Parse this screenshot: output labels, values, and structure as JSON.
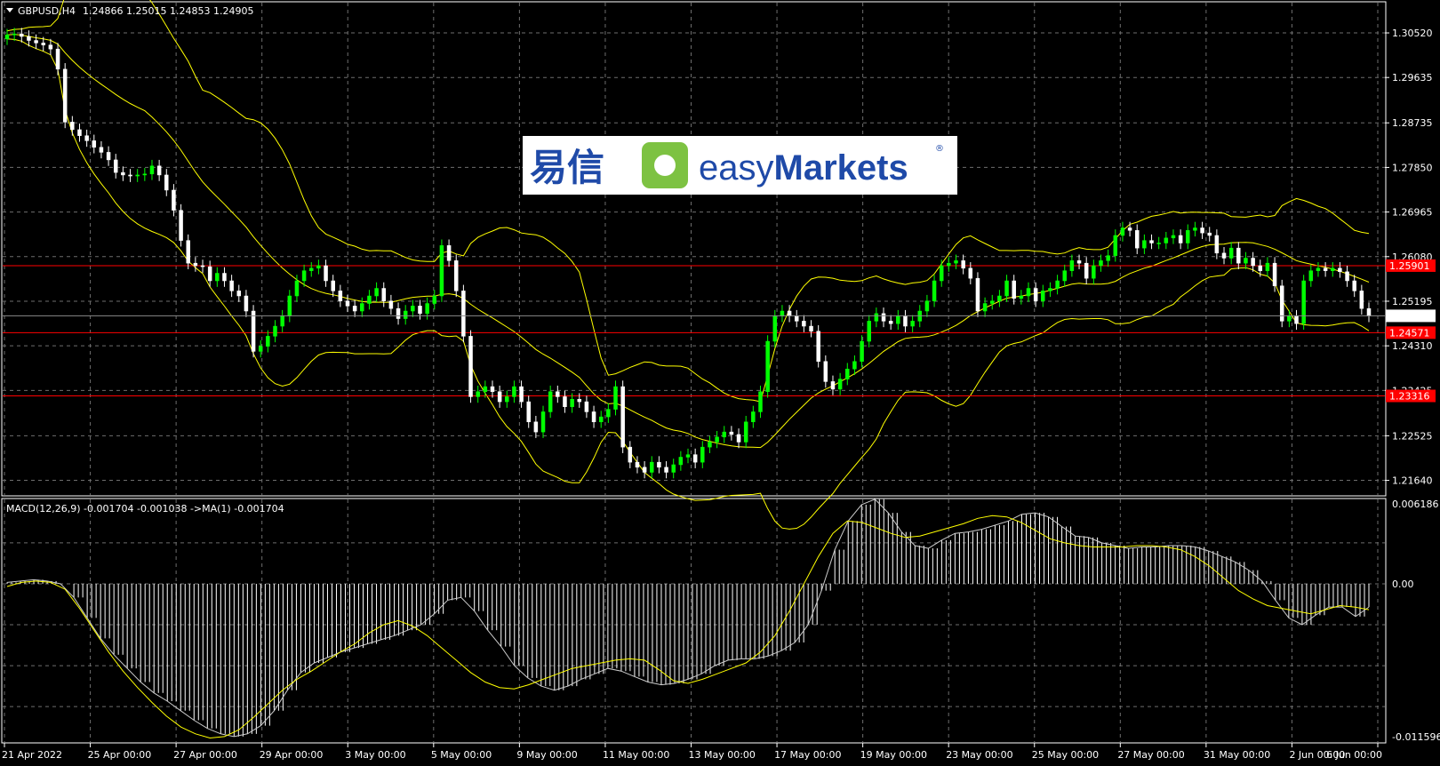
{
  "header": {
    "symbol": "GBPUSD,H4",
    "ohlc": "1.24866 1.25015 1.24853 1.24905"
  },
  "logo": {
    "cn_text": "易信",
    "brand_easy": "easy",
    "brand_markets": "Markets",
    "registered": "®"
  },
  "colors": {
    "background": "#000000",
    "bull_body": "#00ff00",
    "bear_body": "#ffffff",
    "bollinger": "#ffff00",
    "level_lines": "#ff0000",
    "macd_hist": "#ffffff",
    "macd_signal": "#ffff00",
    "grid": "#6e6e6e"
  },
  "price_axis": {
    "ticks": [
      "1.30520",
      "1.29635",
      "1.28735",
      "1.27850",
      "1.26965",
      "1.26080",
      "1.25195",
      "1.24310",
      "1.23425",
      "1.22525",
      "1.21640"
    ],
    "current_price": "1.24905"
  },
  "levels": [
    {
      "label": "1.25901",
      "value": 1.25901
    },
    {
      "label": "1.24571",
      "value": 1.24571
    },
    {
      "label": "1.23316",
      "value": 1.23316
    }
  ],
  "macd_panel": {
    "label": "MACD(12,26,9) -0.001704 -0.001038  ->MA(1) -0.001704",
    "ticks": [
      "0.006186",
      "0.00",
      "-0.011596"
    ]
  },
  "time_axis": {
    "labels": [
      "21 Apr 2022",
      "25 Apr 00:00",
      "27 Apr 00:00",
      "29 Apr 00:00",
      "3 May 00:00",
      "5 May 00:00",
      "9 May 00:00",
      "11 May 00:00",
      "13 May 00:00",
      "17 May 00:00",
      "19 May 00:00",
      "23 May 00:00",
      "25 May 00:00",
      "27 May 00:00",
      "31 May 00:00",
      "2 Jun 00:00",
      "6 Jun 00:00"
    ]
  },
  "chart_data": [
    {
      "type": "candlestick",
      "title": "GBPUSD,H4",
      "ylim": [
        1.2135,
        1.3112
      ],
      "series": [
        {
          "name": "close",
          "values": [
            1.3048,
            1.305,
            1.3045,
            1.3037,
            1.3032,
            1.3028,
            1.302,
            1.298,
            1.2875,
            1.286,
            1.2848,
            1.2838,
            1.2825,
            1.2815,
            1.28,
            1.2775,
            1.277,
            1.2768,
            1.277,
            1.2772,
            1.2788,
            1.277,
            1.274,
            1.27,
            1.264,
            1.2595,
            1.259,
            1.2588,
            1.256,
            1.2575,
            1.256,
            1.254,
            1.253,
            1.25,
            1.242,
            1.243,
            1.245,
            1.247,
            1.249,
            1.253,
            1.256,
            1.258,
            1.2585,
            1.259,
            1.256,
            1.254,
            1.252,
            1.251,
            1.25,
            1.2515,
            1.253,
            1.2545,
            1.252,
            1.2505,
            1.2485,
            1.25,
            1.251,
            1.2495,
            1.2515,
            1.253,
            1.263,
            1.26,
            1.254,
            1.245,
            1.233,
            1.234,
            1.235,
            1.234,
            1.232,
            1.233,
            1.235,
            1.232,
            1.228,
            1.226,
            1.23,
            1.234,
            1.233,
            1.231,
            1.2325,
            1.232,
            1.23,
            1.228,
            1.229,
            1.2305,
            1.235,
            1.223,
            1.22,
            1.219,
            1.218,
            1.22,
            1.219,
            1.218,
            1.2195,
            1.221,
            1.2215,
            1.22,
            1.223,
            1.224,
            1.225,
            1.226,
            1.2255,
            1.224,
            1.228,
            1.23,
            1.234,
            1.244,
            1.249,
            1.25,
            1.249,
            1.248,
            1.247,
            1.246,
            1.24,
            1.236,
            1.2345,
            1.2365,
            1.2385,
            1.24,
            1.244,
            1.248,
            1.2495,
            1.248,
            1.2475,
            1.249,
            1.247,
            1.248,
            1.25,
            1.252,
            1.256,
            1.259,
            1.2595,
            1.26,
            1.2585,
            1.2565,
            1.25,
            1.2515,
            1.252,
            1.253,
            1.256,
            1.2525,
            1.253,
            1.2545,
            1.252,
            1.254,
            1.2545,
            1.256,
            1.258,
            1.26,
            1.2595,
            1.2565,
            1.259,
            1.26,
            1.261,
            1.265,
            1.2665,
            1.266,
            1.2625,
            1.264,
            1.2635,
            1.2635,
            1.2645,
            1.265,
            1.2635,
            1.266,
            1.2665,
            1.2655,
            1.265,
            1.2615,
            1.2605,
            1.2625,
            1.2595,
            1.2605,
            1.259,
            1.258,
            1.2595,
            1.255,
            1.248,
            1.249,
            1.2475,
            1.256,
            1.258,
            1.2585,
            1.258,
            1.2585,
            1.2578,
            1.256,
            1.254,
            1.2505,
            1.249
          ]
        }
      ]
    },
    {
      "type": "line",
      "title": "MACD(12,26,9)",
      "ylim": [
        -0.011596,
        0.006186
      ],
      "series": [
        {
          "name": "MACD",
          "values": [
            0.0001,
            0.0002,
            0.0003,
            0.0002,
            0.0,
            -0.001,
            -0.0025,
            -0.004,
            -0.0052,
            -0.0062,
            -0.0072,
            -0.008,
            -0.0086,
            -0.0093,
            -0.01,
            -0.0106,
            -0.011,
            -0.0112,
            -0.011,
            -0.0104,
            -0.0093,
            -0.0078,
            -0.0065,
            -0.0058,
            -0.0054,
            -0.005,
            -0.0047,
            -0.0044,
            -0.0041,
            -0.0038,
            -0.0034,
            -0.003,
            -0.0022,
            -0.0012,
            -0.001,
            -0.002,
            -0.0034,
            -0.0046,
            -0.006,
            -0.0069,
            -0.0075,
            -0.0078,
            -0.0075,
            -0.007,
            -0.0066,
            -0.0062,
            -0.0064,
            -0.0068,
            -0.0072,
            -0.0074,
            -0.0073,
            -0.007,
            -0.0066,
            -0.006,
            -0.0056,
            -0.0055,
            -0.0055,
            -0.0053,
            -0.0049,
            -0.0043,
            -0.003,
            -0.0005,
            0.0025,
            0.0046,
            0.0058,
            0.0062,
            0.0052,
            0.0038,
            0.0028,
            0.0026,
            0.0032,
            0.0037,
            0.0038,
            0.004,
            0.0043,
            0.0046,
            0.0051,
            0.0052,
            0.0049,
            0.0042,
            0.0035,
            0.0034,
            0.003,
            0.0028,
            0.0026,
            0.0027,
            0.0027,
            0.0028,
            0.0028,
            0.0027,
            0.0024,
            0.002,
            0.0016,
            0.001,
            0.0002,
            -0.0012,
            -0.0025,
            -0.003,
            -0.0023,
            -0.0017,
            -0.0017,
            -0.0024,
            -0.0017
          ]
        },
        {
          "name": "Signal",
          "values": [
            -0.0002,
            0.0001,
            0.0002,
            0.0001,
            -0.0004,
            -0.0018,
            -0.0034,
            -0.005,
            -0.0064,
            -0.0076,
            -0.0087,
            -0.0097,
            -0.0105,
            -0.011,
            -0.0113,
            -0.0112,
            -0.0107,
            -0.0098,
            -0.0088,
            -0.0078,
            -0.007,
            -0.0064,
            -0.0057,
            -0.005,
            -0.0044,
            -0.0036,
            -0.003,
            -0.0027,
            -0.0031,
            -0.0038,
            -0.0047,
            -0.0056,
            -0.0065,
            -0.0072,
            -0.0076,
            -0.0077,
            -0.0074,
            -0.007,
            -0.0066,
            -0.0062,
            -0.006,
            -0.0058,
            -0.0056,
            -0.0055,
            -0.0056,
            -0.0063,
            -0.0071,
            -0.0073,
            -0.007,
            -0.0066,
            -0.0062,
            -0.0058,
            -0.005,
            -0.0038,
            -0.002,
            0.0,
            0.002,
            0.0037,
            0.0046,
            0.0045,
            0.0041,
            0.0037,
            0.0034,
            0.0035,
            0.0038,
            0.0041,
            0.0044,
            0.0048,
            0.005,
            0.0049,
            0.0045,
            0.0039,
            0.0033,
            0.003,
            0.0028,
            0.0027,
            0.0027,
            0.0027,
            0.0028,
            0.0028,
            0.0027,
            0.0025,
            0.002,
            0.0013,
            0.0004,
            -0.0005,
            -0.0011,
            -0.0016,
            -0.0018,
            -0.002,
            -0.0022,
            -0.0019,
            -0.0016,
            -0.0017,
            -0.0019
          ]
        }
      ]
    }
  ]
}
